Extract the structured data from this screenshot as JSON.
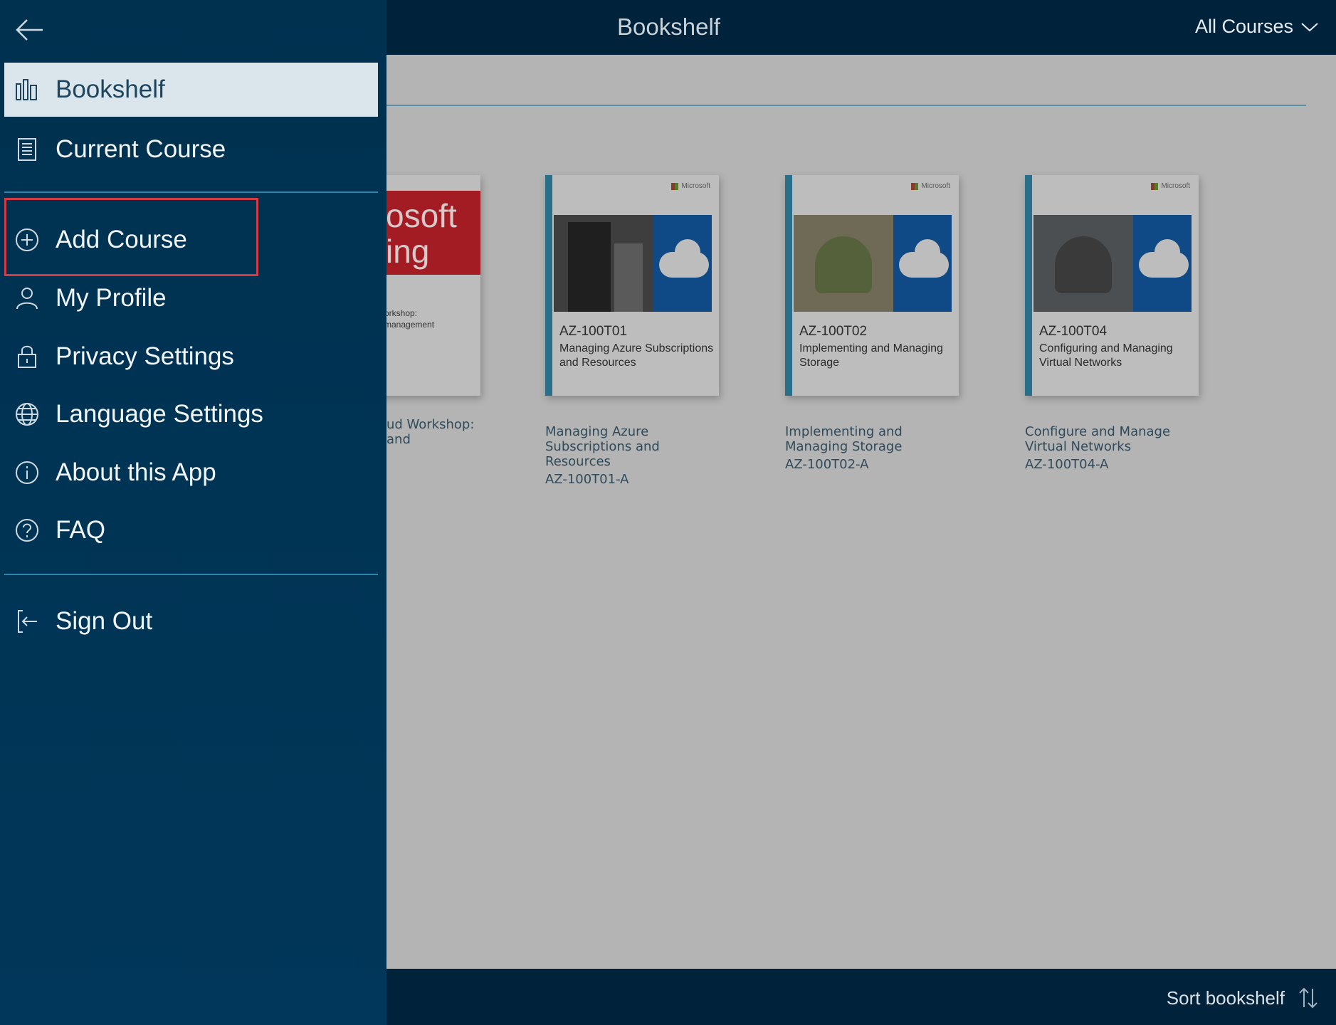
{
  "topbar": {
    "title": "Bookshelf",
    "filter_label": "All Courses"
  },
  "menu": {
    "items": [
      {
        "label": "Bookshelf",
        "icon": "bookshelf-icon",
        "active": true
      },
      {
        "label": "Current Course",
        "icon": "document-icon"
      },
      {
        "label": "Add Course",
        "icon": "plus-circle-icon"
      },
      {
        "label": "My Profile",
        "icon": "person-icon"
      },
      {
        "label": "Privacy Settings",
        "icon": "lock-icon"
      },
      {
        "label": "Language Settings",
        "icon": "globe-icon"
      },
      {
        "label": "About this App",
        "icon": "info-icon"
      },
      {
        "label": "FAQ",
        "icon": "question-icon"
      },
      {
        "label": "Sign Out",
        "icon": "sign-out-icon"
      }
    ]
  },
  "books": [
    {
      "partial_cover_text": "osoft\ning",
      "partial_cover_small": "orkshop:\nmanagement",
      "partial_name": "ud Workshop:\nand"
    },
    {
      "cover_code": "AZ-100T01",
      "cover_subtitle": "Managing Azure Subscriptions and Resources",
      "name": "Managing Azure Subscriptions and Resources",
      "id": "AZ-100T01-A"
    },
    {
      "cover_code": "AZ-100T02",
      "cover_subtitle": "Implementing and Managing Storage",
      "name": "Implementing and Managing Storage",
      "id": "AZ-100T02-A"
    },
    {
      "cover_code": "AZ-100T04",
      "cover_subtitle": "Configuring and Managing Virtual Networks",
      "name": "Configure and Manage Virtual Networks",
      "id": "AZ-100T04-A"
    }
  ],
  "cover_brand": "Microsoft",
  "bottombar": {
    "sort_label": "Sort bookshelf"
  },
  "colors": {
    "menu_bg": "#00314f",
    "topbar_bg": "#00223a",
    "active_item_bg": "#dbe6ec",
    "highlight": "#d63a45"
  }
}
